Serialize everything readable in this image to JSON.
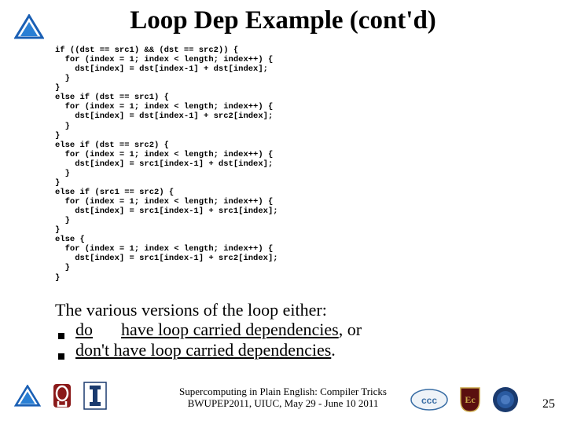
{
  "title": "Loop Dep Example (cont'd)",
  "code": "if ((dst == src1) && (dst == src2)) {\n  for (index = 1; index < length; index++) {\n    dst[index] = dst[index-1] + dst[index];\n  }\n}\nelse if (dst == src1) {\n  for (index = 1; index < length; index++) {\n    dst[index] = dst[index-1] + src2[index];\n  }\n}\nelse if (dst == src2) {\n  for (index = 1; index < length; index++) {\n    dst[index] = src1[index-1] + dst[index];\n  }\n}\nelse if (src1 == src2) {\n  for (index = 1; index < length; index++) {\n    dst[index] = src1[index-1] + src1[index];\n  }\n}\nelse {\n  for (index = 1; index < length; index++) {\n    dst[index] = src1[index-1] + src2[index];\n  }\n}",
  "body": {
    "intro": "The various versions of the loop either:",
    "bullet1_pre": "do",
    "bullet1_mid": "have loop carried dependencies",
    "bullet1_suffix": ", or",
    "bullet2_pre": "don't have loop carried dependencies",
    "bullet2_suffix": "."
  },
  "footer": {
    "line1": "Supercomputing in Plain English: Compiler Tricks",
    "line2": "BWUPEP2011, UIUC, May 29 - June 10 2011"
  },
  "page_number": "25",
  "icons": {
    "top_logo": "blue-delta-logo",
    "bottom_left_1": "blue-delta-logo",
    "bottom_left_2": "ou-logo",
    "bottom_left_3": "illinois-logo",
    "bottom_right_1": "ccc-logo",
    "bottom_right_2": "ec-shield-logo",
    "bottom_right_3": "seal-logo"
  }
}
